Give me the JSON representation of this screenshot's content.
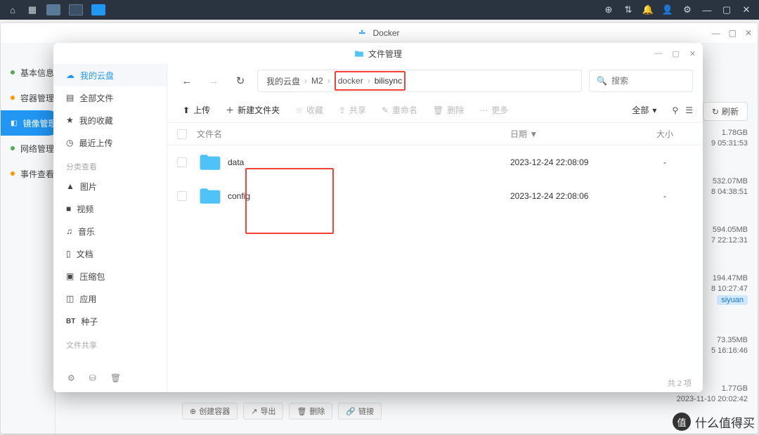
{
  "os_bar": {},
  "docker": {
    "title": "Docker",
    "sidebar": {
      "items": [
        {
          "label": "基本信息"
        },
        {
          "label": "容器管理"
        },
        {
          "label": "镜像管理"
        },
        {
          "label": "网络管理"
        },
        {
          "label": "事件查看"
        }
      ]
    },
    "refresh": "刷新",
    "rows": [
      {
        "size": "1.78GB",
        "time": "9 05:31:53"
      },
      {
        "size": "532.07MB",
        "time": "8 04:38:51"
      },
      {
        "size": "594.05MB",
        "time": "7 22:12:31"
      },
      {
        "size": "194.47MB",
        "time": "8 10:27:47",
        "tag": "siyuan"
      },
      {
        "size": "73.35MB",
        "time": "5 16:16:46"
      },
      {
        "size": "1.77GB",
        "time": "2023-11-10 20:02:42"
      }
    ],
    "bottom_buttons": {
      "create": "创建容器",
      "export": "导出",
      "delete": "删除",
      "link": "链接"
    }
  },
  "fm": {
    "title": "文件管理",
    "sidebar": {
      "my_cloud": "我的云盘",
      "all_files": "全部文件",
      "favorites": "我的收藏",
      "recent": "最近上传",
      "category_header": "分类查看",
      "categories": {
        "image": "图片",
        "video": "视频",
        "music": "音乐",
        "doc": "文档",
        "zip": "压缩包",
        "app": "应用",
        "bt": "种子"
      },
      "share_header": "文件共享"
    },
    "breadcrumb": {
      "root": "我的云盘",
      "m2": "M2",
      "docker": "docker",
      "bilisync": "bilisync"
    },
    "search_placeholder": "搜索",
    "toolbar": {
      "upload": "上传",
      "new_folder": "新建文件夹",
      "favorite": "收藏",
      "share": "共享",
      "rename": "重命名",
      "delete": "删除",
      "more": "更多",
      "all": "全部"
    },
    "columns": {
      "name": "文件名",
      "date": "日期",
      "size": "大小"
    },
    "files": [
      {
        "name": "data",
        "date": "2023-12-24 22:08:09",
        "size": "-"
      },
      {
        "name": "config",
        "date": "2023-12-24 22:08:06",
        "size": "-"
      }
    ],
    "footer": "共 2 项"
  },
  "watermark": {
    "char": "值",
    "text": "什么值得买"
  }
}
